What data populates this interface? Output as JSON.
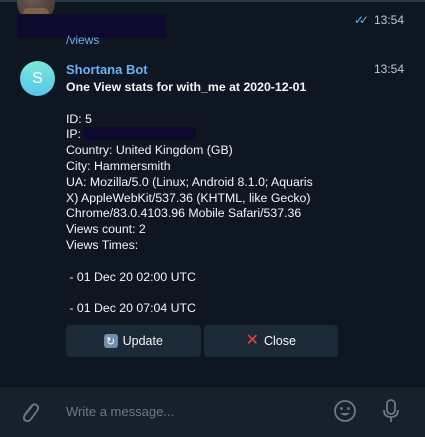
{
  "previous_message": {
    "link_fragment": "/views",
    "time": "13:54",
    "status_icon": "double-check-icon"
  },
  "message": {
    "avatar_initial": "S",
    "sender": "Shortana Bot",
    "time": "13:54",
    "title": "One View stats for with_me at 2020-12-01",
    "lines": {
      "id": "ID: 5",
      "ip": "IP:",
      "country": "Country: United Kingdom (GB)",
      "city": "City: Hammersmith",
      "ua1": "UA: Mozilla/5.0 (Linux; Android 8.1.0; Aquaris",
      "ua2": "X) AppleWebKit/537.36 (KHTML, like Gecko)",
      "ua3": "Chrome/83.0.4103.96 Mobile Safari/537.36",
      "views_count": "Views count: 2",
      "views_times": "Views Times:",
      "time1": " - 01 Dec 20 02:00 UTC",
      "time2": " - 01 Dec 20 07:04 UTC"
    }
  },
  "buttons": {
    "update": "Update",
    "close": "Close"
  },
  "composer": {
    "placeholder": "Write a message..."
  },
  "colors": {
    "background": "#0e1621",
    "accent": "#6ab2f2",
    "close_x": "#e5433d"
  }
}
